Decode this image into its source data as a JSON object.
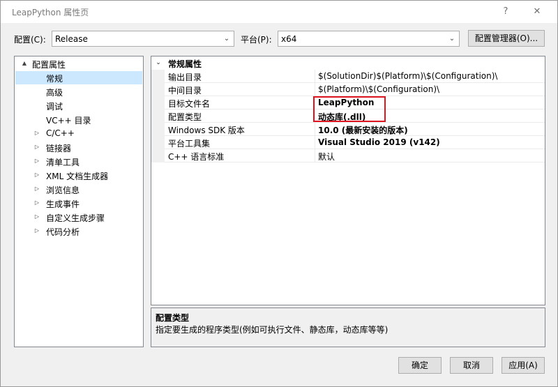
{
  "window": {
    "title": "LeapPython 属性页",
    "help_label": "?",
    "close_label": "✕"
  },
  "toolbar": {
    "config_label": "配置(C):",
    "config_value": "Release",
    "platform_label": "平台(P):",
    "platform_value": "x64",
    "config_manager_label": "配置管理器(O)..."
  },
  "tree": {
    "root": "配置属性",
    "items": [
      {
        "label": "常规",
        "selected": true
      },
      {
        "label": "高级"
      },
      {
        "label": "调试"
      },
      {
        "label": "VC++ 目录"
      },
      {
        "label": "C/C++"
      },
      {
        "label": "链接器"
      },
      {
        "label": "清单工具"
      },
      {
        "label": "XML 文档生成器"
      },
      {
        "label": "浏览信息"
      },
      {
        "label": "生成事件"
      },
      {
        "label": "自定义生成步骤"
      },
      {
        "label": "代码分析"
      }
    ]
  },
  "grid": {
    "category": "常规属性",
    "rows": [
      {
        "name": "输出目录",
        "value": "$(SolutionDir)$(Platform)\\$(Configuration)\\"
      },
      {
        "name": "中间目录",
        "value": "$(Platform)\\$(Configuration)\\"
      },
      {
        "name": "目标文件名",
        "value": "LeapPython"
      },
      {
        "name": "配置类型",
        "value": "动态库(.dll)"
      },
      {
        "name": "Windows SDK 版本",
        "value": "10.0 (最新安装的版本)"
      },
      {
        "name": "平台工具集",
        "value": "Visual Studio 2019 (v142)"
      },
      {
        "name": "C++ 语言标准",
        "value": "默认"
      }
    ]
  },
  "description": {
    "title": "配置类型",
    "text": "指定要生成的程序类型(例如可执行文件、静态库，动态库等等)"
  },
  "buttons": {
    "ok": "确定",
    "cancel": "取消",
    "apply": "应用(A)"
  },
  "icons": {
    "expand_open": "▲",
    "expand_closed": "▷",
    "category_expanded": "⌄",
    "dropdown": "⌄"
  },
  "colors": {
    "selection": "#cce8ff",
    "highlight_box": "#e0141e"
  }
}
